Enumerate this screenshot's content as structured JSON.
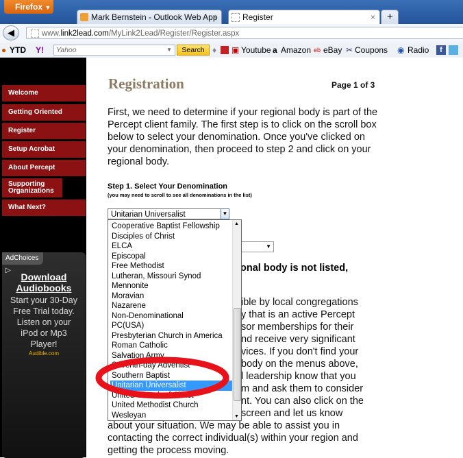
{
  "browser": {
    "menu_button": "Firefox",
    "tabs": [
      {
        "label": "Mark Bernstein - Outlook Web App"
      },
      {
        "label": "Register"
      }
    ],
    "new_tab": "+",
    "close_tab": "×",
    "url_prefix": "www.",
    "url_domain": "link2lead.com",
    "url_path": "/MyLink2Lead/Register/Register.aspx",
    "toolbar": {
      "ytd": "YTD",
      "search_engine": "Yahoo",
      "search_button": "Search",
      "bookmarks": [
        "Youtube",
        "Amazon",
        "eBay",
        "Coupons",
        "Radio"
      ]
    }
  },
  "sidebar": {
    "items": [
      {
        "label": "Welcome"
      },
      {
        "label": "Getting Oriented"
      },
      {
        "label": "Register"
      },
      {
        "label": "Setup Acrobat"
      },
      {
        "label": "About Percept"
      },
      {
        "label": "Supporting Organizations"
      },
      {
        "label": "What Next?"
      }
    ]
  },
  "ad": {
    "adchoices": "AdChoices",
    "title_line1": "Download",
    "title_line2": "Audiobooks",
    "body": "Start your 30-Day Free Trial today. Listen on your iPod or Mp3 Player!",
    "source": "Audible.com"
  },
  "main": {
    "title": "Registration",
    "page_label": "Page 1 of 3",
    "intro": "First, we need to determine if your regional body is part of the Percept client family. The first step is to click on the scroll box below to select your denomination. Once you've clicked on your denomination, then proceed to step 2 and click on your regional body.",
    "step1_title": "Step 1. Select Your Denomination",
    "step1_hint": "(you may need to scroll to see all denominations in the list)",
    "selected_denomination": "Unitarian Universalist",
    "partial_heading": "onal body is not listed,",
    "partial_para": [
      "ible by local congregations",
      "y that is an active Percept",
      "sor memberships for their",
      "nd receive very significant",
      "vices. If you don't find your",
      "body on the menus above,",
      "l leadership know that you",
      "m and ask them to consider",
      "nt. You can also click on the",
      "screen and let us know"
    ],
    "tail_para": [
      "about your situation. We may be able to assist you in",
      "contacting the correct individual(s) within your region and",
      "getting the process moving."
    ],
    "denominations": [
      "Cooperative Baptist Fellowship",
      "Disciples of Christ",
      "ELCA",
      "Episcopal",
      "Free Methodist",
      "Lutheran, Missouri Synod",
      "Mennonite",
      "Moravian",
      "Nazarene",
      "Non-Denominational",
      "PC(USA)",
      "Presbyterian Church in America",
      "Roman Catholic",
      "Salvation Army",
      "Seventh-day Adventist",
      "Southern Baptist",
      "Unitarian Universalist",
      "United Church of Christ",
      "United Methodist Church",
      "Wesleyan"
    ],
    "selected_index": 16
  },
  "colors": {
    "sidebar_item": "#8b1113",
    "title": "#8c7a60",
    "highlight_circle": "#e8121a",
    "selection": "#3399ff"
  }
}
